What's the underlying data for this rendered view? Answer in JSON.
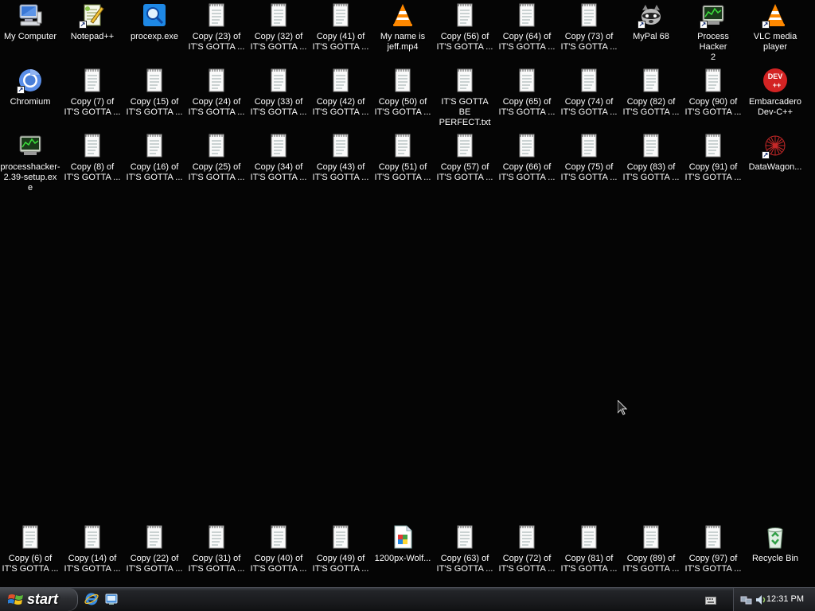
{
  "desktop": {
    "icons": [
      {
        "label": "My Computer",
        "icon": "my-computer-icon",
        "type": "computer"
      },
      {
        "label": "Notepad++",
        "icon": "notepadpp-icon",
        "type": "notepadpp",
        "shortcut": true
      },
      {
        "label": "procexp.exe",
        "icon": "procexp-icon",
        "type": "procexp"
      },
      {
        "label": "Copy (23) of\nIT'S GOTTA ...",
        "icon": "text-file-icon",
        "type": "txt"
      },
      {
        "label": "Copy (32) of\nIT'S GOTTA ...",
        "icon": "text-file-icon",
        "type": "txt"
      },
      {
        "label": "Copy (41) of\nIT'S GOTTA ...",
        "icon": "text-file-icon",
        "type": "txt"
      },
      {
        "label": "My name is\njeff.mp4",
        "icon": "vlc-media-file-icon",
        "type": "vlc"
      },
      {
        "label": "Copy (56) of\nIT'S GOTTA ...",
        "icon": "text-file-icon",
        "type": "txt"
      },
      {
        "label": "Copy (64) of\nIT'S GOTTA ...",
        "icon": "text-file-icon",
        "type": "txt"
      },
      {
        "label": "Copy (73) of\nIT'S GOTTA ...",
        "icon": "text-file-icon",
        "type": "txt"
      },
      {
        "label": "MyPal 68",
        "icon": "mypal-icon",
        "type": "mypal",
        "shortcut": true
      },
      {
        "label": "Process Hacker\n2",
        "icon": "process-hacker-icon",
        "type": "phacker",
        "shortcut": true
      },
      {
        "label": "VLC media\nplayer",
        "icon": "vlc-icon",
        "type": "vlc",
        "shortcut": true
      },
      {
        "label": "Chromium",
        "icon": "chromium-icon",
        "type": "chromium",
        "shortcut": true
      },
      {
        "label": "Copy (7) of\nIT'S GOTTA ...",
        "icon": "text-file-icon",
        "type": "txt"
      },
      {
        "label": "Copy (15) of\nIT'S GOTTA ...",
        "icon": "text-file-icon",
        "type": "txt"
      },
      {
        "label": "Copy (24) of\nIT'S GOTTA ...",
        "icon": "text-file-icon",
        "type": "txt"
      },
      {
        "label": "Copy (33) of\nIT'S GOTTA ...",
        "icon": "text-file-icon",
        "type": "txt"
      },
      {
        "label": "Copy (42) of\nIT'S GOTTA ...",
        "icon": "text-file-icon",
        "type": "txt"
      },
      {
        "label": "Copy (50) of\nIT'S GOTTA ...",
        "icon": "text-file-icon",
        "type": "txt"
      },
      {
        "label": "IT'S GOTTA BE\nPERFECT.txt",
        "icon": "text-file-icon",
        "type": "txt"
      },
      {
        "label": "Copy (65) of\nIT'S GOTTA ...",
        "icon": "text-file-icon",
        "type": "txt"
      },
      {
        "label": "Copy (74) of\nIT'S GOTTA ...",
        "icon": "text-file-icon",
        "type": "txt"
      },
      {
        "label": "Copy (82) of\nIT'S GOTTA ...",
        "icon": "text-file-icon",
        "type": "txt"
      },
      {
        "label": "Copy (90) of\nIT'S GOTTA ...",
        "icon": "text-file-icon",
        "type": "txt"
      },
      {
        "label": "Embarcadero\nDev-C++",
        "icon": "devcpp-icon",
        "type": "devcpp"
      },
      {
        "label": "processhacker-\n2.39-setup.ex\ne",
        "icon": "setup-exe-icon",
        "type": "phacker"
      },
      {
        "label": "Copy (8) of\nIT'S GOTTA ...",
        "icon": "text-file-icon",
        "type": "txt"
      },
      {
        "label": "Copy (16) of\nIT'S GOTTA ...",
        "icon": "text-file-icon",
        "type": "txt"
      },
      {
        "label": "Copy (25) of\nIT'S GOTTA ...",
        "icon": "text-file-icon",
        "type": "txt"
      },
      {
        "label": "Copy (34) of\nIT'S GOTTA ...",
        "icon": "text-file-icon",
        "type": "txt"
      },
      {
        "label": "Copy (43) of\nIT'S GOTTA ...",
        "icon": "text-file-icon",
        "type": "txt"
      },
      {
        "label": "Copy (51) of\nIT'S GOTTA ...",
        "icon": "text-file-icon",
        "type": "txt"
      },
      {
        "label": "Copy (57) of\nIT'S GOTTA ...",
        "icon": "text-file-icon",
        "type": "txt"
      },
      {
        "label": "Copy (66) of\nIT'S GOTTA ...",
        "icon": "text-file-icon",
        "type": "txt"
      },
      {
        "label": "Copy (75) of\nIT'S GOTTA ...",
        "icon": "text-file-icon",
        "type": "txt"
      },
      {
        "label": "Copy (83) of\nIT'S GOTTA ...",
        "icon": "text-file-icon",
        "type": "txt"
      },
      {
        "label": "Copy (91) of\nIT'S GOTTA ...",
        "icon": "text-file-icon",
        "type": "txt"
      },
      {
        "label": "DataWagon...",
        "icon": "datawagon-icon",
        "type": "datawagon",
        "shortcut": true
      },
      {
        "label": "Copy (6) of\nIT'S GOTTA ...",
        "icon": "text-file-icon",
        "type": "txt"
      },
      {
        "label": "Copy (14) of\nIT'S GOTTA ...",
        "icon": "text-file-icon",
        "type": "txt"
      },
      {
        "label": "Copy (22) of\nIT'S GOTTA ...",
        "icon": "text-file-icon",
        "type": "txt"
      },
      {
        "label": "Copy (31) of\nIT'S GOTTA ...",
        "icon": "text-file-icon",
        "type": "txt"
      },
      {
        "label": "Copy (40) of\nIT'S GOTTA ...",
        "icon": "text-file-icon",
        "type": "txt"
      },
      {
        "label": "Copy (49) of\nIT'S GOTTA ...",
        "icon": "text-file-icon",
        "type": "txt"
      },
      {
        "label": "1200px-Wolf...",
        "icon": "image-file-icon",
        "type": "image"
      },
      {
        "label": "Copy (63) of\nIT'S GOTTA ...",
        "icon": "text-file-icon",
        "type": "txt"
      },
      {
        "label": "Copy (72) of\nIT'S GOTTA ...",
        "icon": "text-file-icon",
        "type": "txt"
      },
      {
        "label": "Copy (81) of\nIT'S GOTTA ...",
        "icon": "text-file-icon",
        "type": "txt"
      },
      {
        "label": "Copy (89) of\nIT'S GOTTA ...",
        "icon": "text-file-icon",
        "type": "txt"
      },
      {
        "label": "Copy (97) of\nIT'S GOTTA ...",
        "icon": "text-file-icon",
        "type": "txt"
      },
      {
        "label": "Recycle Bin",
        "icon": "recycle-bin-icon",
        "type": "recycle"
      }
    ]
  },
  "taskbar": {
    "start_label": "start",
    "quicklaunch": [
      "internet-explorer-icon",
      "show-desktop-icon"
    ],
    "tray_icons": [
      "keyboard-icon",
      "network-icon",
      "volume-icon"
    ],
    "clock": "12:31 PM"
  },
  "colors": {
    "desktop_background": "#050505",
    "taskbar": "#1c1d20",
    "label_text": "#ffffff"
  }
}
